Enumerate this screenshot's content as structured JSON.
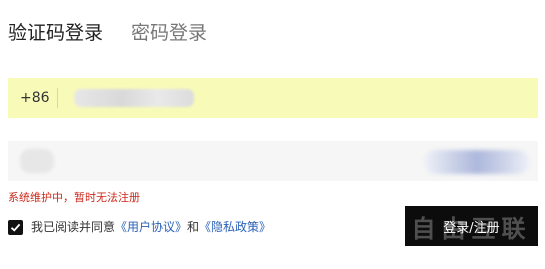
{
  "tabs": [
    {
      "label": "验证码登录",
      "active": true
    },
    {
      "label": "密码登录",
      "active": false
    }
  ],
  "phone": {
    "country_code": "+86",
    "value": ""
  },
  "code": {
    "value": "",
    "send_button": ""
  },
  "error_message": "系统维护中，暂时无法注册",
  "agreement": {
    "checked": true,
    "prefix": "我已阅读并同意",
    "user_agreement": "《用户协议》",
    "and": "和",
    "privacy_policy": "《隐私政策》"
  },
  "submit_label": "登录/注册",
  "watermark": "自由互联",
  "colors": {
    "phone_row_bg": "#f8fbb8",
    "code_row_bg": "#f6f6f6",
    "error": "#cc2a1e",
    "link": "#2a62b8",
    "submit_bg": "#0c0c0c"
  },
  "icons": {
    "checkbox": "check-icon"
  }
}
